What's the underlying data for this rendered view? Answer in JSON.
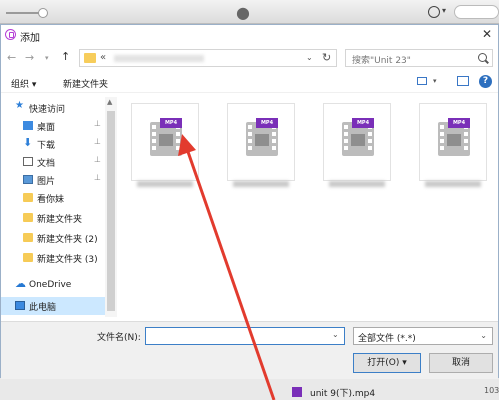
{
  "dialog": {
    "title": "添加",
    "close_glyph": "✕"
  },
  "nav": {
    "back": "←",
    "forward": "→",
    "recent": "▾",
    "up": "↑",
    "address_prefix": "«",
    "address_caret": "⌄",
    "refresh": "↻",
    "search_placeholder": "搜索\"Unit 23\""
  },
  "toolbar": {
    "organize": "组织 ▾",
    "new_folder": "新建文件夹",
    "view_caret": "▾",
    "help": "?"
  },
  "sidebar": {
    "items": [
      {
        "label": "快速访问",
        "icon": "star-icon"
      },
      {
        "label": "桌面",
        "icon": "desktop-icon",
        "pinned": true
      },
      {
        "label": "下载",
        "icon": "download-icon",
        "pinned": true
      },
      {
        "label": "文档",
        "icon": "document-icon",
        "pinned": true
      },
      {
        "label": "图片",
        "icon": "picture-icon",
        "pinned": true
      },
      {
        "label": "看你妹",
        "icon": "folder-icon"
      },
      {
        "label": "新建文件夹",
        "icon": "folder-icon"
      },
      {
        "label": "新建文件夹 (2)",
        "icon": "folder-icon"
      },
      {
        "label": "新建文件夹 (3)",
        "icon": "folder-icon"
      },
      {
        "label": "OneDrive",
        "icon": "cloud-icon"
      },
      {
        "label": "此电脑",
        "icon": "computer-icon"
      }
    ],
    "pin_glyph": "📌"
  },
  "files": {
    "items": [
      {
        "type_tag": "MP4"
      },
      {
        "type_tag": "MP4"
      },
      {
        "type_tag": "MP4"
      },
      {
        "type_tag": "MP4"
      }
    ]
  },
  "footer": {
    "filename_label": "文件名(N):",
    "filename_value": "",
    "filename_caret": "⌄",
    "filetype_label": "全部文件 (*.*)",
    "filetype_caret": "⌄",
    "open": "打开(O)",
    "open_caret": "▾",
    "cancel": "取消"
  },
  "background_list": {
    "row_text": "unit 9(下).mp4",
    "row_size": "103,"
  },
  "colors": {
    "accent": "#3c7fc7",
    "mp4_tag": "#7a2fb8",
    "arrow": "#e23b2e"
  }
}
